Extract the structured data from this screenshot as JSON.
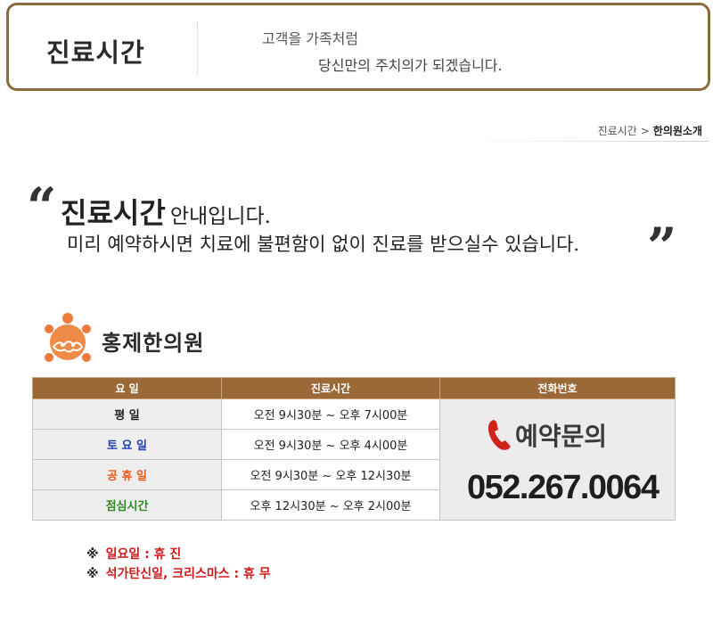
{
  "header": {
    "title": "진료시간",
    "tagline_1": "고객을 가족처럼",
    "tagline_2": "당신만의 주치의가 되겠습니다."
  },
  "breadcrumb": {
    "items": [
      "진료시간",
      "한의원소개"
    ],
    "separator": ">"
  },
  "intro": {
    "quote_open": "“",
    "quote_close": "”",
    "title": "진료시간",
    "title_suffix": "안내입니다.",
    "line2": "미리 예약하시면 치료에 불편함이 없이 진료를 받으실수 있습니다."
  },
  "logo": {
    "name": "홍제한의원",
    "icon": "sun-cloud-logo-icon"
  },
  "table": {
    "headers": [
      "요  일",
      "진료시간",
      "전화번호"
    ],
    "rows": [
      {
        "day": "평    일",
        "time": "오전 9시30분 ~ 오후 7시00분",
        "color": "#222222"
      },
      {
        "day": "토 요 일",
        "time": "오전 9시30분 ~ 오후 4시00분",
        "color": "#1f3fb0"
      },
      {
        "day": "공 휴 일",
        "time": "오전 9시30분 ~ 오후 12시30분",
        "color": "#e8591c"
      },
      {
        "day": "점심시간",
        "time": "오후 12시30분 ~ 오후 2시00분",
        "color": "#2e8a22"
      }
    ],
    "contact_label": "예약문의",
    "contact_icon": "phone-icon",
    "phone": "052.267.0064"
  },
  "notes": [
    {
      "mark": "※",
      "text": "일요일 : 휴 진"
    },
    {
      "mark": "※",
      "text": "석가탄신일, 크리스마스 : 휴 무"
    }
  ],
  "colors": {
    "brand_brown": "#9b6838",
    "frame_brown": "#8a6a3f",
    "logo_orange": "#ef7a3a",
    "note_red": "#d11a1a",
    "phone_red": "#d0231c"
  }
}
